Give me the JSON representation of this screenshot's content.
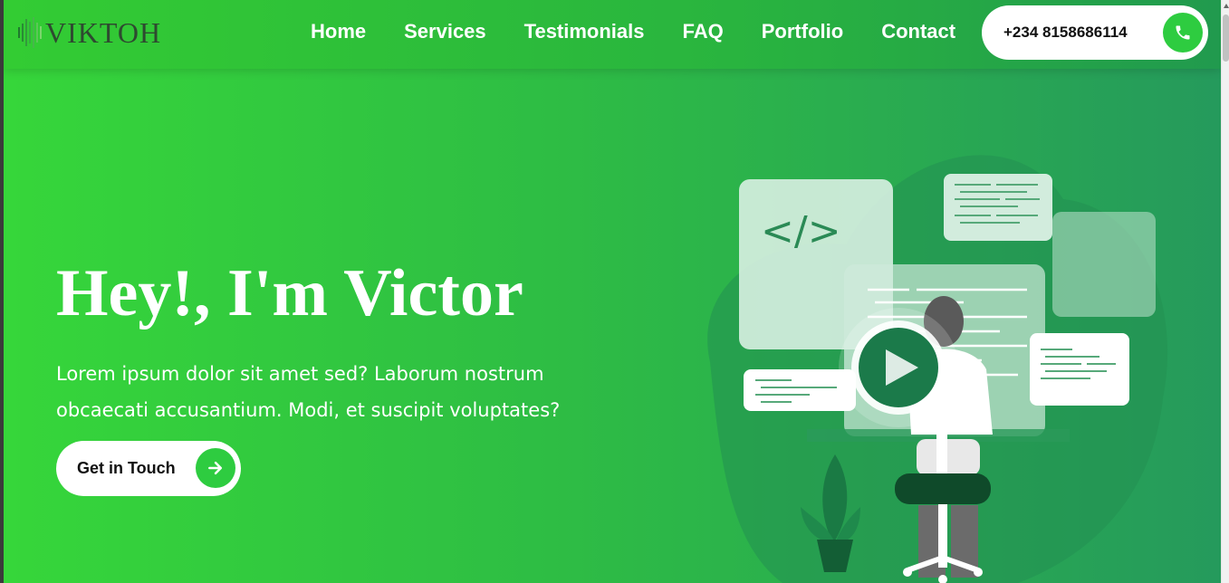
{
  "header": {
    "logo_text": "VIKTOH",
    "nav": [
      {
        "label": "Home"
      },
      {
        "label": "Services"
      },
      {
        "label": "Testimonials"
      },
      {
        "label": "FAQ"
      },
      {
        "label": "Portfolio"
      },
      {
        "label": "Contact"
      }
    ],
    "phone": "+234 8158686114"
  },
  "hero": {
    "title": "Hey!, I'm Victor",
    "description": "Lorem ipsum dolor sit amet sed? Laborum nostrum obcaecati accusantium. Modi, et suscipit voluptates?",
    "cta_label": "Get in Touch"
  },
  "icons": {
    "phone": "phone-icon",
    "cta_arrow": "arrow-right-icon",
    "play": "play-icon"
  },
  "colors": {
    "accent": "#2ecc40",
    "hero_start": "#36d63a",
    "hero_end": "#259a5c",
    "illustration_dark": "#1b7a4a"
  }
}
